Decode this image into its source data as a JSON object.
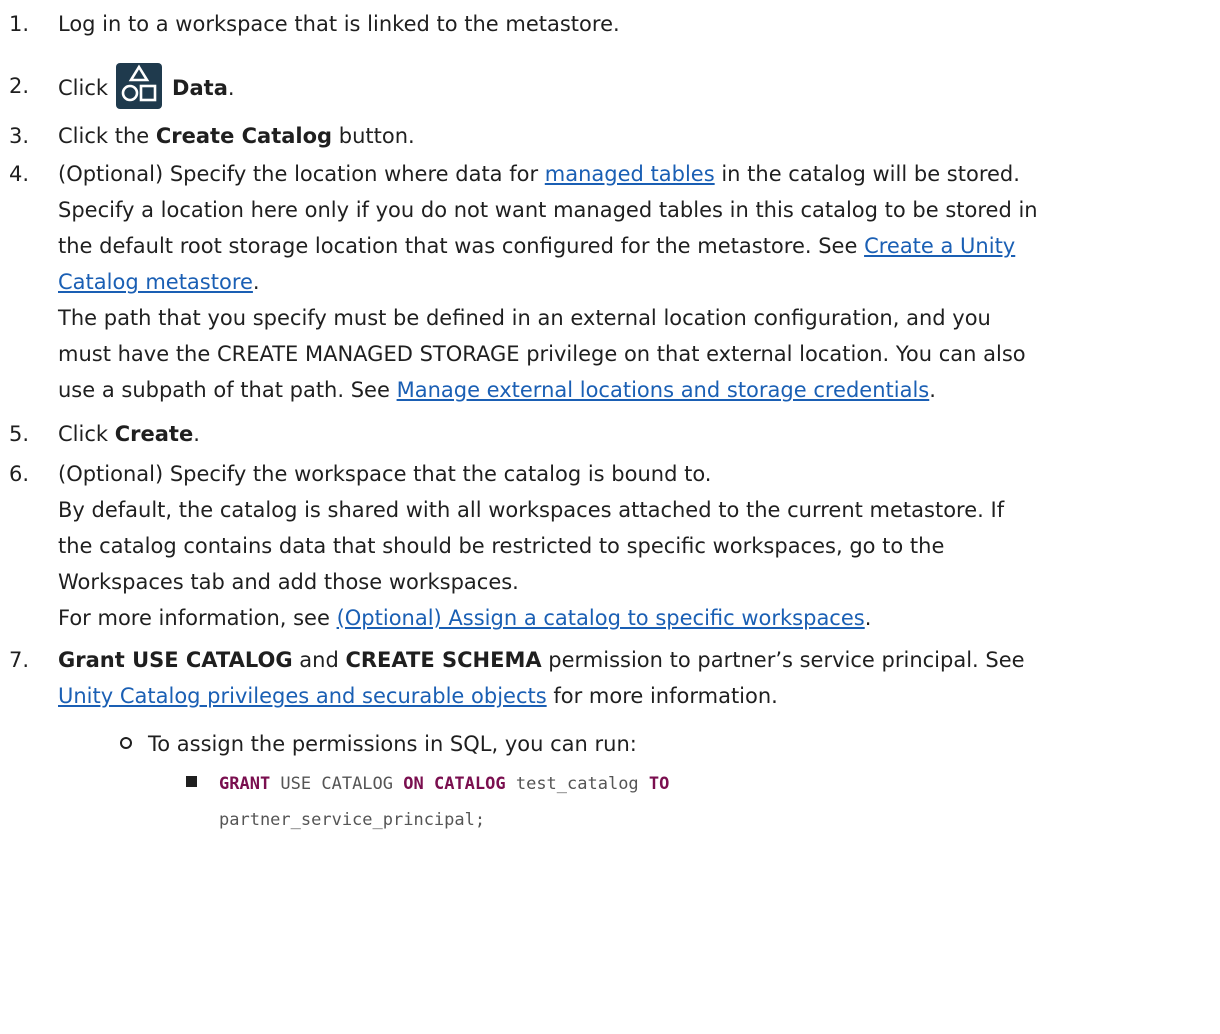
{
  "steps": [
    {
      "num": "1.",
      "lines": [
        [
          "Log in to a workspace that is linked to the metastore."
        ]
      ]
    },
    {
      "num": "2.",
      "click": "Click",
      "bold": "Data",
      "icon": "data-icon"
    },
    {
      "num": "3.",
      "pre": "Click the ",
      "bold": "Create Catalog",
      "post": " button."
    },
    {
      "num": "4.",
      "l1a": "(Optional) Specify the location where data for ",
      "l1link": "managed tables",
      "l1b": " in the catalog will be stored.",
      "l2": "Specify a location here only if you do not want managed tables in this catalog to be stored in",
      "l3a": "the default root storage location that was configured for the metastore. See ",
      "l3link": "Create a Unity",
      "l4link": "Catalog metastore",
      "l4b": ".",
      "l5": "The path that you specify must be defined in an external location configuration, and you",
      "l6": "must have the CREATE MANAGED STORAGE privilege on that external location. You can also",
      "l7a": "use a subpath of that path. See ",
      "l7link": "Manage external locations and storage credentials",
      "l7b": "."
    },
    {
      "num": "5.",
      "pre": "Click ",
      "bold": "Create",
      "post": "."
    },
    {
      "num": "6.",
      "l1": "(Optional) Specify the workspace that the catalog is bound to.",
      "l2": "By default, the catalog is shared with all workspaces attached to the current metastore. If",
      "l3": "the catalog contains data that should be restricted to specific workspaces, go to the",
      "l4": "Workspaces tab and add those workspaces.",
      "l5a": "For more information, see ",
      "l5link": "(Optional) Assign a catalog to specific workspaces",
      "l5b": "."
    },
    {
      "num": "7.",
      "b1": "Grant USE CATALOG",
      "t1": " and ",
      "b2": "CREATE SCHEMA",
      "t2": " permission to partner’s  service principal. See",
      "l2link": "Unity Catalog privileges and securable objects",
      "l2b": " for more information.",
      "sub": "To assign the permissions in SQL, you can run:",
      "code": {
        "k1": "GRANT",
        "t1": " USE CATALOG ",
        "k2": "ON CATALOG",
        "t2": " test_catalog ",
        "k3": "TO",
        "line2": "partner_service_principal;"
      }
    }
  ]
}
